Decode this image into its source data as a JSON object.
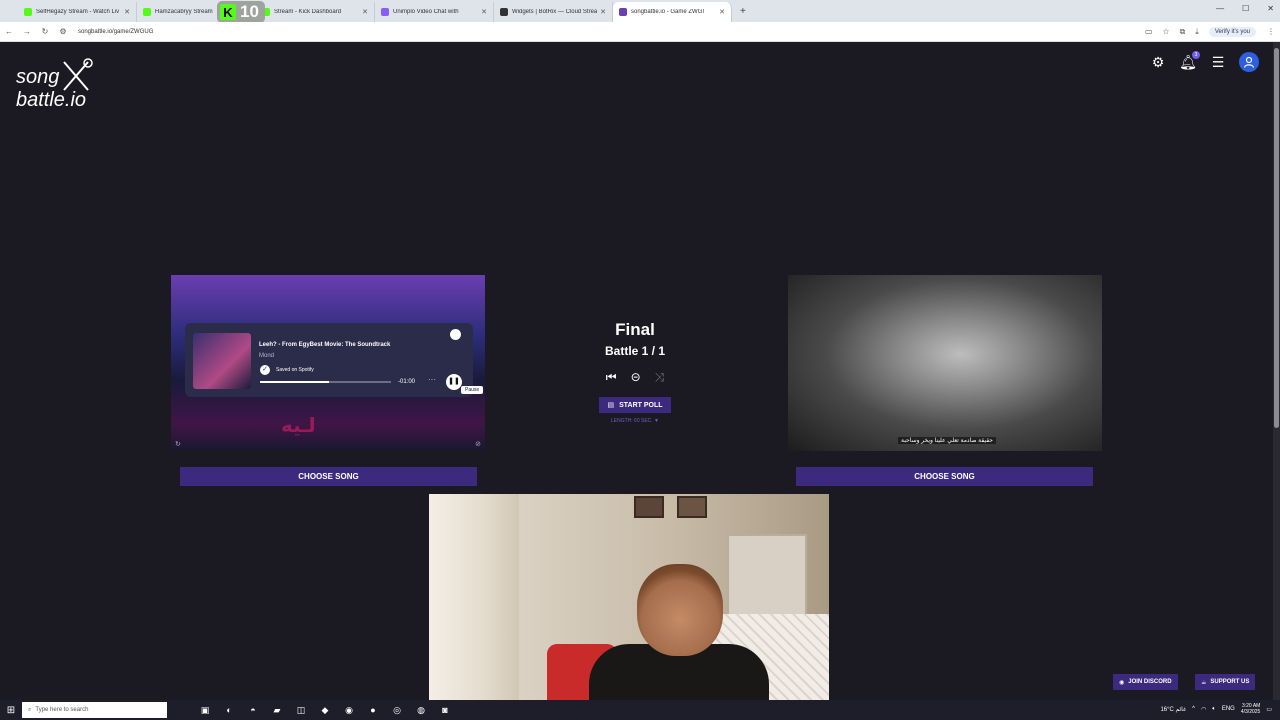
{
  "browser": {
    "tabs": [
      {
        "label": "SelfHegazy Stream - Watch Liv",
        "color": "#53fc18"
      },
      {
        "label": "Hamzacabryy Stream",
        "color": "#53fc18"
      },
      {
        "label": "Stream - Kick Dashboard",
        "color": "#53fc18"
      },
      {
        "label": "Unimplo Video Chat with",
        "color": "#8a5cf6"
      },
      {
        "label": "Widgets | BotRix — Cloud Strea",
        "color": "#333333"
      },
      {
        "label": "songbattle.io - Game ZWGI",
        "color": "#6a3fb0"
      }
    ],
    "kick_badge": {
      "letter": "K",
      "count": "10"
    },
    "new_tab": "+",
    "url": "songbattle.io/game/ZWGUG",
    "verify_label": "Verify it's you"
  },
  "site": {
    "logo_line1": "song",
    "logo_line2": "battle.io",
    "round_title": "Final",
    "battle_count": "Battle 1 / 1",
    "start_poll_label": "START POLL",
    "poll_length": "LENGTH: 60 SEC. ▼",
    "choose_song_left": "CHOOSE SONG",
    "choose_song_right": "CHOOSE SONG",
    "join_discord": "JOIN DISCORD",
    "support_us": "SUPPORT US",
    "notification_count": "3"
  },
  "spotify": {
    "title": "Leeh? - From EgyBest Movie: The Soundtrack",
    "artist": "Mond",
    "saved": "Saved on Spotify",
    "remaining": "-01:00",
    "tooltip": "Pause",
    "progress": 0.53,
    "pink_text": "لـيه"
  },
  "right_card": {
    "caption": "حقيقة صادمة تعلي علينا ويخر وساحبة"
  },
  "taskbar": {
    "search_placeholder": "Type here to search",
    "weather": "16°C غائم",
    "lang": "ENG",
    "time": "3:20 AM",
    "date": "4/3/2025"
  }
}
